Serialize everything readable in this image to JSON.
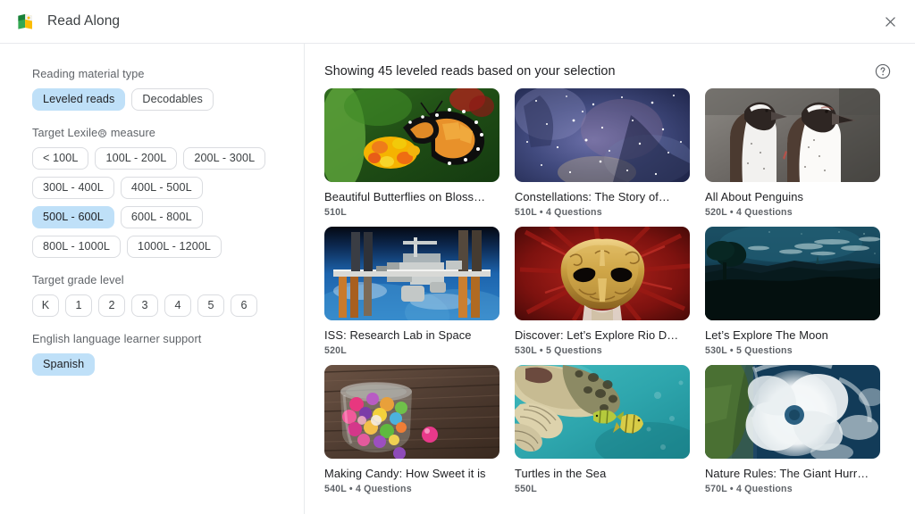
{
  "app": {
    "title": "Read Along",
    "logo_icon": "read-along-book-logo",
    "close_icon": "close-icon"
  },
  "sidebar": {
    "sections": [
      {
        "id": "reading-material-type",
        "label": "Reading material type",
        "options": [
          {
            "label": "Leveled reads",
            "selected": true
          },
          {
            "label": "Decodables",
            "selected": false
          }
        ]
      },
      {
        "id": "target-lexile-measure",
        "label_before": "Target Lexile",
        "label_mark": "R",
        "label_after": "measure",
        "label": "Target Lexile® measure",
        "options": [
          {
            "label": "< 100L",
            "selected": false
          },
          {
            "label": "100L - 200L",
            "selected": false
          },
          {
            "label": "200L - 300L",
            "selected": false
          },
          {
            "label": "300L - 400L",
            "selected": false
          },
          {
            "label": "400L - 500L",
            "selected": false
          },
          {
            "label": "500L - 600L",
            "selected": true
          },
          {
            "label": "600L - 800L",
            "selected": false
          },
          {
            "label": "800L - 1000L",
            "selected": false
          },
          {
            "label": "1000L - 1200L",
            "selected": false
          }
        ]
      },
      {
        "id": "target-grade-level",
        "label": "Target grade level",
        "options": [
          {
            "label": "K",
            "selected": false
          },
          {
            "label": "1",
            "selected": false
          },
          {
            "label": "2",
            "selected": false
          },
          {
            "label": "3",
            "selected": false
          },
          {
            "label": "4",
            "selected": false
          },
          {
            "label": "5",
            "selected": false
          },
          {
            "label": "6",
            "selected": false
          }
        ]
      },
      {
        "id": "english-language-learner-support",
        "label": "English language learner support",
        "options": [
          {
            "label": "Spanish",
            "selected": true
          }
        ]
      }
    ]
  },
  "main": {
    "heading": "Showing 45 leveled reads based on your selection",
    "help_icon": "help-circle-icon",
    "cards": [
      {
        "title": "Beautiful Butterflies on Bloss…",
        "meta": "510L",
        "thumb": "butterfly-on-flowers"
      },
      {
        "title": "Constellations: The Story of…",
        "meta": "510L  •  4 Questions",
        "thumb": "night-sky-galaxy"
      },
      {
        "title": "All About Penguins",
        "meta": "520L  •  4 Questions",
        "thumb": "two-penguins"
      },
      {
        "title": "ISS: Research Lab in Space",
        "meta": "520L",
        "thumb": "space-station-over-earth"
      },
      {
        "title": "Discover: Let’s Explore Rio D…",
        "meta": "530L  •  5 Questions",
        "thumb": "golden-carnival-mask"
      },
      {
        "title": "Let’s Explore The Moon",
        "meta": "530L  •  5 Questions",
        "thumb": "night-landscape"
      },
      {
        "title": "Making Candy: How Sweet it is",
        "meta": "540L  •  4 Questions",
        "thumb": "candy-jar-on-wood"
      },
      {
        "title": "Turtles in the Sea",
        "meta": "550L",
        "thumb": "sea-turtle-underwater"
      },
      {
        "title": "Nature Rules: The Giant Hurr…",
        "meta": "570L  •  4 Questions",
        "thumb": "hurricane-satellite"
      }
    ]
  },
  "colors": {
    "selected_chip_bg": "#bfe0f8",
    "chip_border": "#dadce0",
    "text_primary": "#202124",
    "text_secondary": "#5f6368",
    "divider": "#e8eaed"
  }
}
